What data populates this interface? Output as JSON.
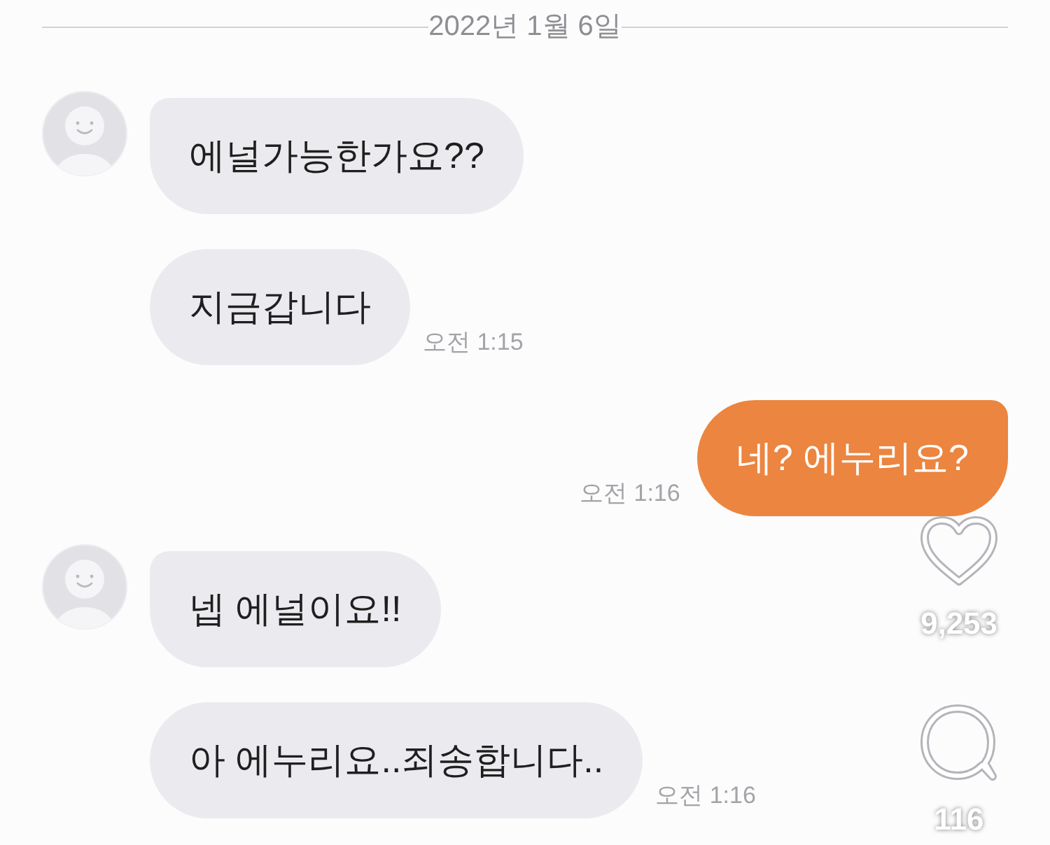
{
  "date_divider": "2022년 1월 6일",
  "messages": [
    {
      "kind": "received",
      "avatar": true,
      "text": "에널가능한가요??"
    },
    {
      "kind": "received",
      "avatar": false,
      "text": "지금갑니다",
      "time": "오전 1:15"
    },
    {
      "kind": "sent",
      "text": "네? 에누리요?",
      "time": "오전 1:16"
    },
    {
      "kind": "received",
      "avatar": true,
      "text": "넵 에널이요!!"
    },
    {
      "kind": "received",
      "avatar": false,
      "text": "아 에누리요..죄송합니다..",
      "time": "오전 1:16"
    }
  ],
  "reactions": [
    {
      "kind": "like",
      "count": "9,253"
    },
    {
      "kind": "comment",
      "count": "116"
    }
  ]
}
